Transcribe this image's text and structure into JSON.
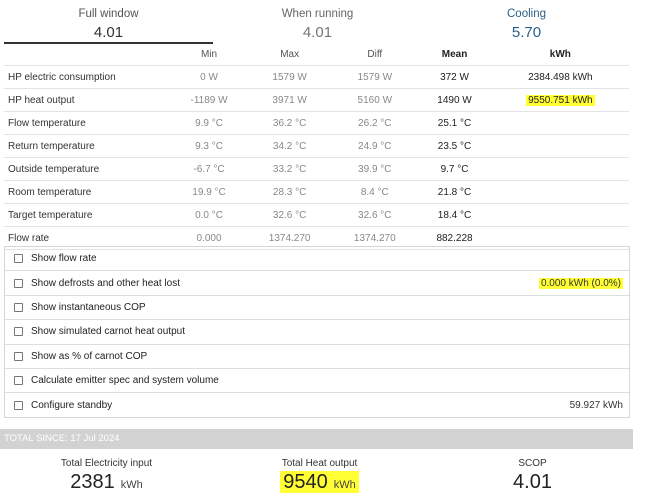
{
  "tabs": [
    {
      "label": "Full window",
      "value": "4.01"
    },
    {
      "label": "When running",
      "value": "4.01"
    },
    {
      "label": "Cooling",
      "value": "5.70"
    }
  ],
  "table": {
    "headers": [
      "",
      "Min",
      "Max",
      "Diff",
      "Mean",
      "kWh"
    ],
    "rows": [
      {
        "name": "HP electric consumption",
        "min": "0 W",
        "max": "1579 W",
        "diff": "1579 W",
        "mean": "372 W",
        "kwh": "2384.498 kWh"
      },
      {
        "name": "HP heat output",
        "min": "-1189 W",
        "max": "3971 W",
        "diff": "5160 W",
        "mean": "1490 W",
        "kwh": "9550.751 kWh"
      },
      {
        "name": "Flow temperature",
        "min": "9.9 °C",
        "max": "36.2 °C",
        "diff": "26.2 °C",
        "mean": "25.1 °C",
        "kwh": ""
      },
      {
        "name": "Return temperature",
        "min": "9.3 °C",
        "max": "34.2 °C",
        "diff": "24.9 °C",
        "mean": "23.5 °C",
        "kwh": ""
      },
      {
        "name": "Outside temperature",
        "min": "-6.7 °C",
        "max": "33.2 °C",
        "diff": "39.9 °C",
        "mean": "9.7 °C",
        "kwh": ""
      },
      {
        "name": "Room temperature",
        "min": "19.9 °C",
        "max": "28.3 °C",
        "diff": "8.4 °C",
        "mean": "21.8 °C",
        "kwh": ""
      },
      {
        "name": "Target temperature",
        "min": "0.0 °C",
        "max": "32.6 °C",
        "diff": "32.6 °C",
        "mean": "18.4 °C",
        "kwh": ""
      },
      {
        "name": "Flow rate",
        "min": "0.000",
        "max": "1374.270",
        "diff": "1374.270",
        "mean": "882.228",
        "kwh": ""
      }
    ]
  },
  "options": [
    {
      "label": "Show flow rate",
      "right": ""
    },
    {
      "label": "Show defrosts and other heat lost",
      "right": "0.000 kWh (0.0%)"
    },
    {
      "label": "Show instantaneous COP",
      "right": ""
    },
    {
      "label": "Show simulated carnot heat output",
      "right": ""
    },
    {
      "label": "Show as % of carnot COP",
      "right": ""
    },
    {
      "label": "Calculate emitter spec and system volume",
      "right": ""
    },
    {
      "label": "Configure standby",
      "right": "59.927 kWh"
    }
  ],
  "totals": {
    "bar_label": "TOTAL SINCE: 17 Jul 2024",
    "electricity": {
      "label": "Total Electricity input",
      "value": "2381",
      "unit": "kWh"
    },
    "heat": {
      "label": "Total Heat output",
      "value": "9540",
      "unit": "kWh"
    },
    "scop": {
      "label": "SCOP",
      "value": "4.01"
    }
  },
  "colors": {
    "highlight": "#ffff33",
    "accent": "#2b5f86",
    "bar": "#d2d2d2"
  }
}
